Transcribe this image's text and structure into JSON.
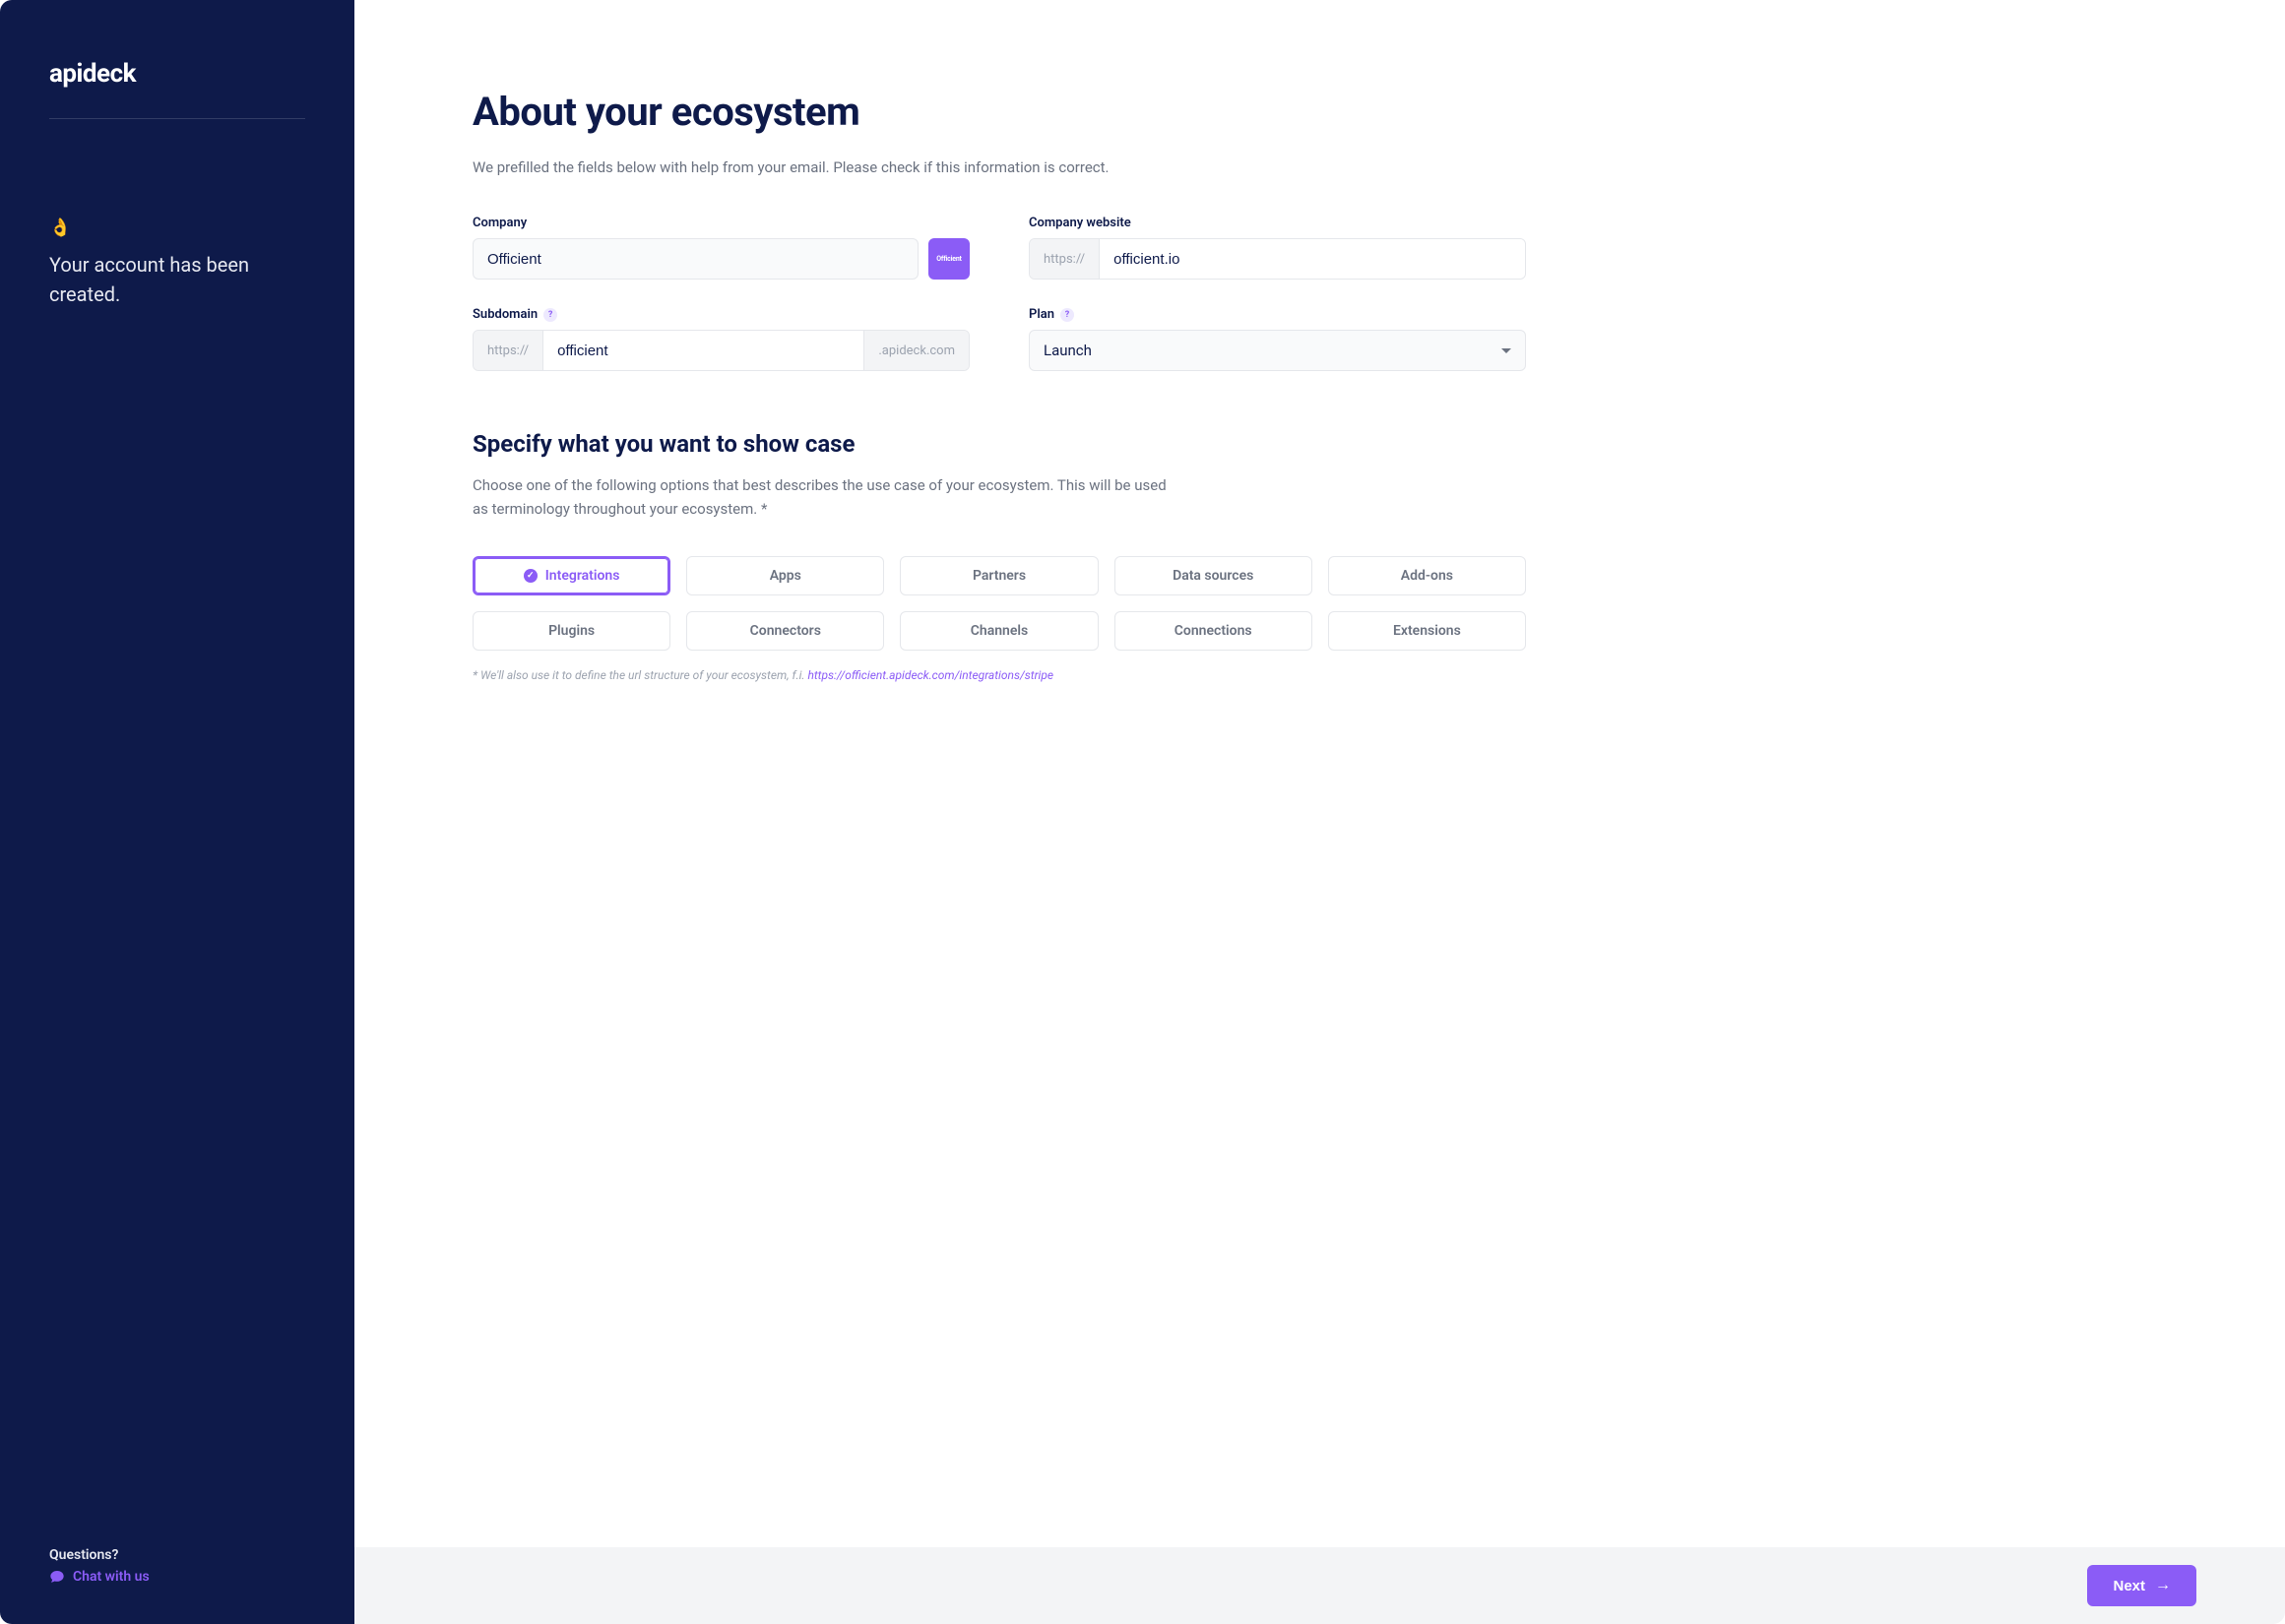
{
  "sidebar": {
    "brand": "apideck",
    "emoji": "👌",
    "account_created_text": "Your account has been created.",
    "questions_label": "Questions?",
    "chat_label": "Chat with us"
  },
  "page": {
    "title": "About your ecosystem",
    "subtitle": "We prefilled the fields below with help from your email. Please check if this information is correct."
  },
  "form": {
    "company_label": "Company",
    "company_value": "Officient",
    "company_logo_text": "Officient",
    "website_label": "Company website",
    "website_prefix": "https://",
    "website_value": "officient.io",
    "subdomain_label": "Subdomain",
    "subdomain_prefix": "https://",
    "subdomain_value": "officient",
    "subdomain_suffix": ".apideck.com",
    "plan_label": "Plan",
    "plan_value": "Launch"
  },
  "section2": {
    "title": "Specify what you want to show case",
    "subtitle": "Choose one of the following options that best describes the use case of your ecosystem. This will be used as terminology throughout your ecosystem. *",
    "options": [
      "Integrations",
      "Apps",
      "Partners",
      "Data sources",
      "Add-ons",
      "Plugins",
      "Connectors",
      "Channels",
      "Connections",
      "Extensions"
    ],
    "selected_index": 0,
    "footnote_prefix": "* We'll also use it to define the url structure of your ecosystem, f.i. ",
    "footnote_link": "https://officient.apideck.com/integrations/stripe"
  },
  "footer": {
    "next_label": "Next"
  }
}
